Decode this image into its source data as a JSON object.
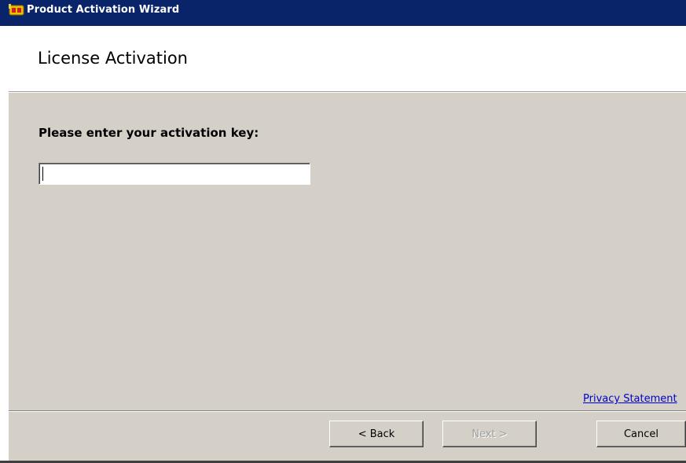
{
  "window": {
    "title": "Product Activation Wizard",
    "title_bar_color": "#0a246a",
    "app_icon": "activation-wizard-icon"
  },
  "header": {
    "heading": "License Activation"
  },
  "content": {
    "prompt": "Please enter your activation key:",
    "activation_key": {
      "value": "",
      "placeholder": ""
    },
    "privacy_link": "Privacy Statement"
  },
  "footer": {
    "back_label": "< Back",
    "next_label": "Next >",
    "next_enabled": false,
    "cancel_label": "Cancel"
  }
}
